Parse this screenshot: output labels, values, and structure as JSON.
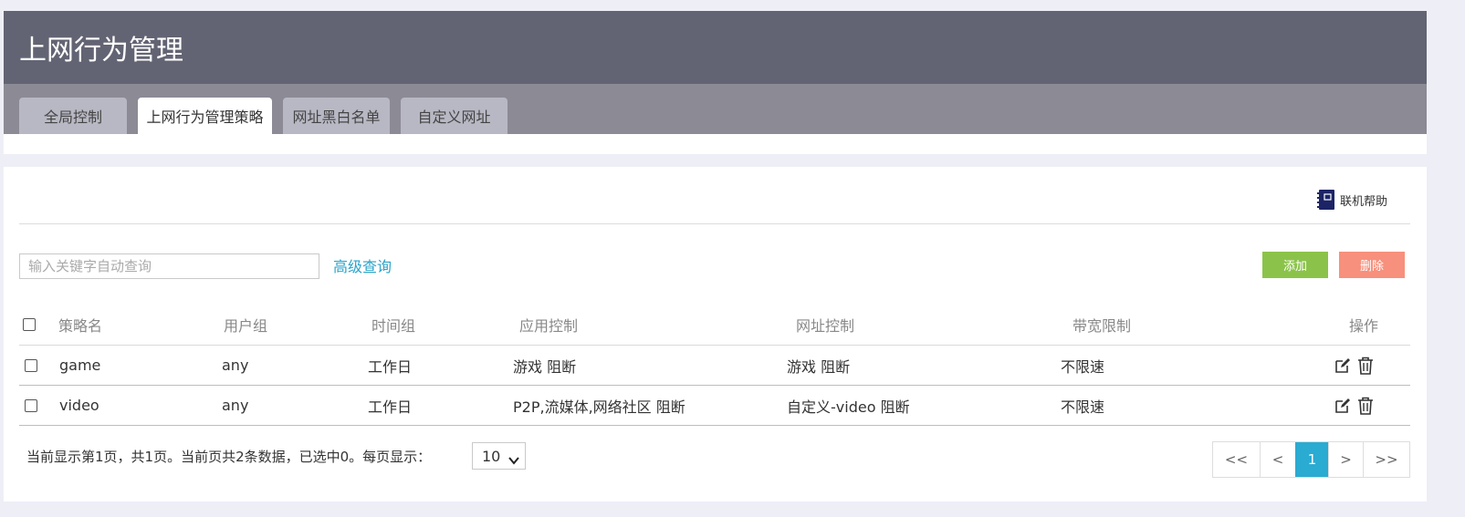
{
  "page": {
    "title": "上网行为管理"
  },
  "tabs": [
    {
      "label": "全局控制",
      "active": false
    },
    {
      "label": "上网行为管理策略",
      "active": true
    },
    {
      "label": "网址黑白名单",
      "active": false
    },
    {
      "label": "自定义网址",
      "active": false
    }
  ],
  "toolbar": {
    "help_label": "联机帮助",
    "search_placeholder": "输入关键字自动查询",
    "advanced_search_label": "高级查询",
    "add_label": "添加",
    "delete_label": "删除"
  },
  "table": {
    "columns": [
      "策略名",
      "用户组",
      "时间组",
      "应用控制",
      "网址控制",
      "带宽限制",
      "操作"
    ],
    "rows": [
      {
        "name": "game",
        "user_group": "any",
        "time_group": "工作日",
        "app_control": "游戏 阻断",
        "url_control": "游戏 阻断",
        "bandwidth": "不限速",
        "checked": false
      },
      {
        "name": "video",
        "user_group": "any",
        "time_group": "工作日",
        "app_control": "P2P,流媒体,网络社区 阻断",
        "url_control": "自定义-video 阻断",
        "bandwidth": "不限速",
        "checked": false
      }
    ]
  },
  "pager": {
    "info": "当前显示第1页，共1页。当前页共2条数据，已选中0。每页显示：",
    "page_size": "10",
    "first": "<<",
    "prev": "<",
    "current": "1",
    "next": ">",
    "last": ">>"
  },
  "colors": {
    "header_bg": "#636473",
    "tab_bar_bg": "#8b8a95",
    "accent": "#2aabd2",
    "add_button": "#8bc34a",
    "delete_button": "#f7907c"
  }
}
